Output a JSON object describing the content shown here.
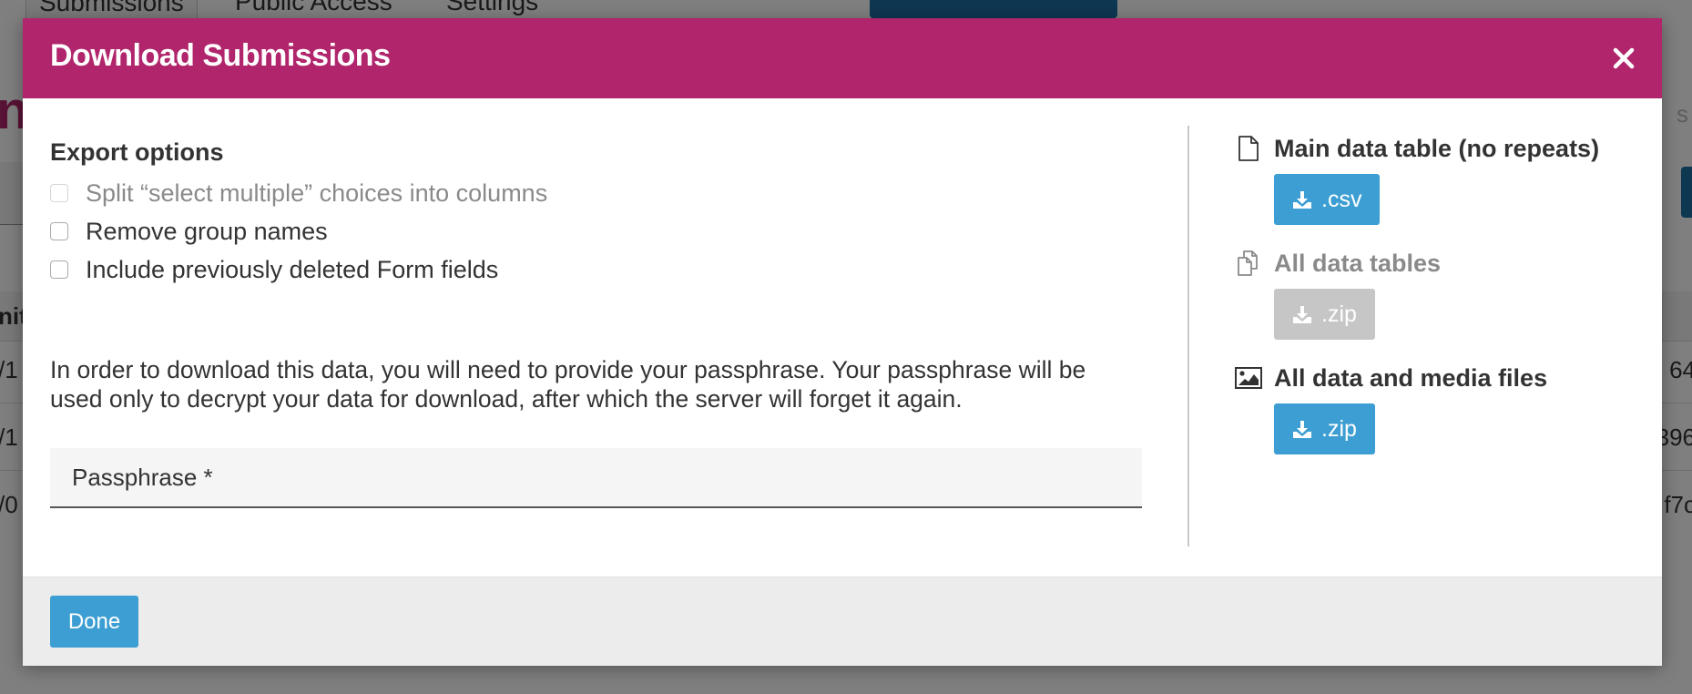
{
  "background": {
    "tabs": [
      "Submissions",
      "Public Access",
      "Settings"
    ],
    "title_fragment": "n",
    "header_fragment_left": "nit",
    "row_fragments_left": [
      "/1",
      "/1",
      "/0"
    ],
    "row_fragments_right": [
      "64",
      "396",
      "f7c"
    ],
    "faint_fragment_right": "s"
  },
  "modal": {
    "title": "Download Submissions",
    "close_label": "×",
    "export_options": {
      "heading": "Export options",
      "options": [
        {
          "label": "Split “select multiple” choices into columns",
          "checked": false,
          "disabled": true
        },
        {
          "label": "Remove group names",
          "checked": false,
          "disabled": false
        },
        {
          "label": "Include previously deleted Form fields",
          "checked": false,
          "disabled": false
        }
      ]
    },
    "passphrase_info": "In order to download this data, you will need to provide your passphrase. Your passphrase will be used only to decrypt your data for download, after which the server will forget it again.",
    "passphrase": {
      "placeholder": "Passphrase *",
      "value": ""
    },
    "downloads": [
      {
        "title": "Main data table (no repeats)",
        "button": ".csv",
        "disabled": false,
        "icon": "file-icon"
      },
      {
        "title": "All data tables",
        "button": ".zip",
        "disabled": true,
        "icon": "files-icon"
      },
      {
        "title": "All data and media files",
        "button": ".zip",
        "disabled": false,
        "icon": "image-icon"
      }
    ],
    "footer": {
      "done_label": "Done"
    }
  },
  "colors": {
    "header": "#b0256b",
    "button": "#3c9ed2",
    "button_disabled": "#c6c6c6",
    "footer": "#ececec"
  }
}
